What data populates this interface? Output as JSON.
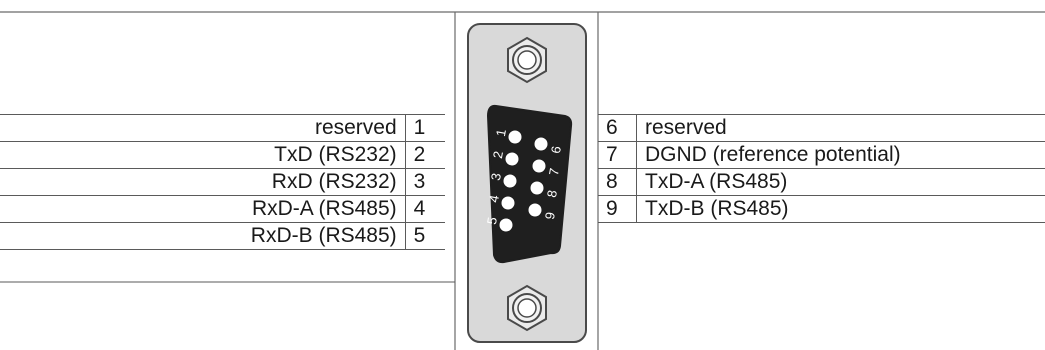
{
  "left_pins": [
    {
      "label": "reserved",
      "num": "1"
    },
    {
      "label": "TxD (RS232)",
      "num": "2"
    },
    {
      "label": "RxD (RS232)",
      "num": "3"
    },
    {
      "label": "RxD-A (RS485)",
      "num": "4"
    },
    {
      "label": "RxD-B (RS485)",
      "num": "5"
    }
  ],
  "right_pins": [
    {
      "num": "6",
      "label": "reserved"
    },
    {
      "num": "7",
      "label": "DGND (reference potential)"
    },
    {
      "num": "8",
      "label": "TxD-A (RS485)"
    },
    {
      "num": "9",
      "label": "TxD-B (RS485)"
    }
  ],
  "connector": {
    "pin_numbers": [
      "1",
      "2",
      "3",
      "4",
      "5",
      "6",
      "7",
      "8",
      "9"
    ],
    "colors": {
      "housing": "#d9d9d9",
      "shell": "#1f1f1f",
      "line": "#4a4a4a"
    }
  }
}
